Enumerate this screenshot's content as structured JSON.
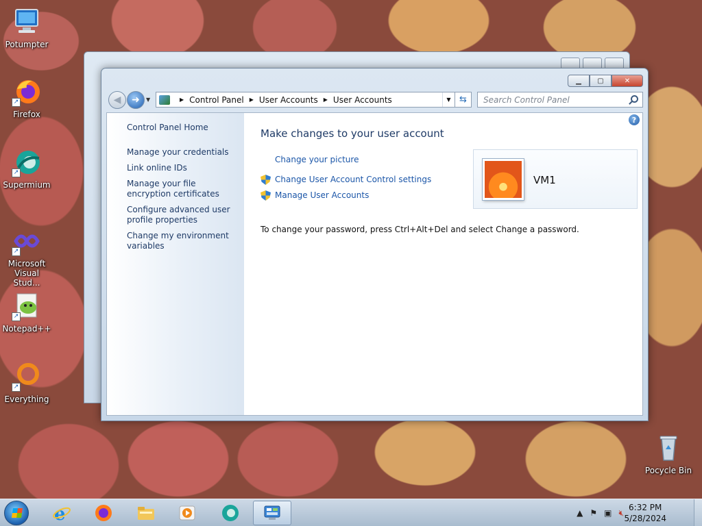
{
  "desktop": {
    "icons": [
      {
        "label": "Potumpter"
      },
      {
        "label": "Firefox"
      },
      {
        "label": "Supermium"
      },
      {
        "label": "Microsoft Visual Stud..."
      },
      {
        "label": "Notepad++"
      },
      {
        "label": "Everything"
      },
      {
        "label": "Pocycle Bin"
      }
    ]
  },
  "window": {
    "address": {
      "crumbs": [
        "Control Panel",
        "User Accounts",
        "User Accounts"
      ]
    },
    "search": {
      "placeholder": "Search Control Panel"
    },
    "sidebar": {
      "home": "Control Panel Home",
      "links": [
        "Manage your credentials",
        "Link online IDs",
        "Manage your file encryption certificates",
        "Configure advanced user profile properties",
        "Change my environment variables"
      ]
    },
    "main": {
      "heading": "Make changes to your user account",
      "tasks": [
        "Change your picture",
        "Change User Account Control settings",
        "Manage User Accounts"
      ],
      "info": "To change your password, press Ctrl+Alt+Del and select Change a password.",
      "account_name": "VM1"
    }
  },
  "taskbar": {
    "clock_time": "6:32 PM",
    "clock_date": "5/28/2024"
  },
  "colors": {
    "link": "#1b56a8",
    "heading": "#1e3a66",
    "close_button": "#c6452f",
    "taskbar": "#a9bccf"
  }
}
